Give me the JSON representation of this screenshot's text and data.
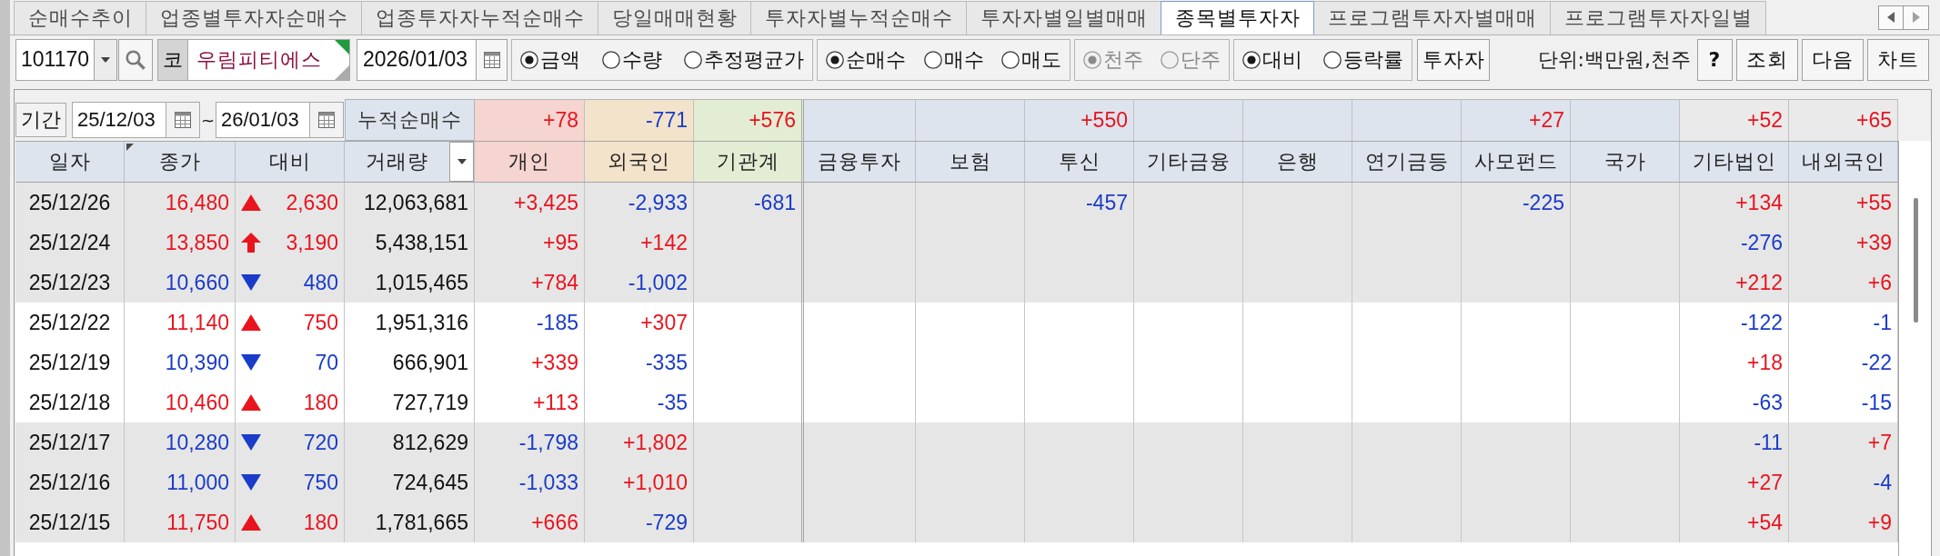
{
  "tabs": [
    {
      "label": "순매수추이",
      "selected": false
    },
    {
      "label": "업종별투자자순매수",
      "selected": false
    },
    {
      "label": "업종투자자누적순매수",
      "selected": false
    },
    {
      "label": "당일매매현황",
      "selected": false
    },
    {
      "label": "투자자별누적순매수",
      "selected": false
    },
    {
      "label": "투자자별일별매매",
      "selected": false
    },
    {
      "label": "종목별투자자",
      "selected": true
    },
    {
      "label": "프로그램투자자별매매",
      "selected": false
    },
    {
      "label": "프로그램투자자일별",
      "selected": false
    }
  ],
  "toolbar": {
    "stock_code": "101170",
    "market": "코",
    "stock_name": "우림피티에스",
    "date": "2026/01/03",
    "radio_groups": [
      {
        "disabled": false,
        "options": [
          {
            "label": "금액",
            "selected": true
          },
          {
            "label": "수량",
            "selected": false
          },
          {
            "label": "추정평균가",
            "selected": false
          }
        ]
      },
      {
        "disabled": false,
        "options": [
          {
            "label": "순매수",
            "selected": true
          },
          {
            "label": "매수",
            "selected": false
          },
          {
            "label": "매도",
            "selected": false
          }
        ]
      },
      {
        "disabled": true,
        "options": [
          {
            "label": "천주",
            "selected": true
          },
          {
            "label": "단주",
            "selected": false
          }
        ]
      },
      {
        "disabled": false,
        "options": [
          {
            "label": "대비",
            "selected": true
          },
          {
            "label": "등락률",
            "selected": false
          }
        ]
      }
    ],
    "investor_button": "투자자",
    "unit": "단위:백만원,천주",
    "help_button": "?",
    "buttons": [
      "조회",
      "다음",
      "차트"
    ]
  },
  "summary": {
    "period_label": "기간",
    "start_date": "25/12/03",
    "separator": "~",
    "end_date": "26/01/03",
    "label": "누적순매수",
    "values": {
      "individual": {
        "text": "+78",
        "negative": false
      },
      "foreign": {
        "text": "-771",
        "negative": true
      },
      "institution_total": {
        "text": "+576",
        "negative": false
      },
      "investment_trust": {
        "text": "+550",
        "negative": false
      },
      "private_fund": {
        "text": "+27",
        "negative": false
      },
      "other_corporation": {
        "text": "+52",
        "negative": false
      },
      "domestic_foreign": {
        "text": "+65",
        "negative": false
      }
    }
  },
  "table": {
    "columns": [
      {
        "label": "일자",
        "kind": "base",
        "dropdown": false,
        "flagged": false
      },
      {
        "label": "종가",
        "kind": "base",
        "dropdown": false,
        "flagged": true
      },
      {
        "label": "대비",
        "kind": "base",
        "dropdown": false,
        "flagged": false
      },
      {
        "label": "거래량",
        "kind": "base",
        "dropdown": true,
        "flagged": false
      },
      {
        "label": "개인",
        "kind": "individual",
        "dropdown": false,
        "flagged": false
      },
      {
        "label": "외국인",
        "kind": "foreign",
        "dropdown": false,
        "flagged": false
      },
      {
        "label": "기관계",
        "kind": "institution_total",
        "dropdown": false,
        "flagged": false
      },
      {
        "label": "금융투자",
        "kind": "institution",
        "dropdown": false,
        "flagged": false
      },
      {
        "label": "보험",
        "kind": "institution",
        "dropdown": false,
        "flagged": false
      },
      {
        "label": "투신",
        "kind": "institution",
        "dropdown": false,
        "flagged": false
      },
      {
        "label": "기타금융",
        "kind": "institution",
        "dropdown": false,
        "flagged": false
      },
      {
        "label": "은행",
        "kind": "institution",
        "dropdown": false,
        "flagged": false
      },
      {
        "label": "연기금등",
        "kind": "institution",
        "dropdown": false,
        "flagged": false
      },
      {
        "label": "사모펀드",
        "kind": "institution",
        "dropdown": false,
        "flagged": false
      },
      {
        "label": "국가",
        "kind": "institution",
        "dropdown": false,
        "flagged": false
      },
      {
        "label": "기타법인",
        "kind": "other",
        "dropdown": false,
        "flagged": false
      },
      {
        "label": "내외국인",
        "kind": "other",
        "dropdown": false,
        "flagged": false
      }
    ],
    "rows": [
      {
        "date": "25/12/26",
        "close": "16,480",
        "kind": "up",
        "change": "2,630",
        "volume": "12,063,681",
        "values": {
          "individual": {
            "text": "+3,425",
            "negative": false
          },
          "foreign": {
            "text": "-2,933",
            "negative": true
          },
          "institution_total": {
            "text": "-681",
            "negative": true
          },
          "investment_trust": {
            "text": "-457",
            "negative": true
          },
          "private_fund": {
            "text": "-225",
            "negative": true
          },
          "other_corporation": {
            "text": "+134",
            "negative": false
          },
          "domestic_foreign": {
            "text": "+55",
            "negative": false
          }
        }
      },
      {
        "date": "25/12/24",
        "close": "13,850",
        "kind": "limit_up",
        "change": "3,190",
        "volume": "5,438,151",
        "values": {
          "individual": {
            "text": "+95",
            "negative": false
          },
          "foreign": {
            "text": "+142",
            "negative": false
          },
          "other_corporation": {
            "text": "-276",
            "negative": true
          },
          "domestic_foreign": {
            "text": "+39",
            "negative": false
          }
        }
      },
      {
        "date": "25/12/23",
        "close": "10,660",
        "kind": "down",
        "change": "480",
        "volume": "1,015,465",
        "values": {
          "individual": {
            "text": "+784",
            "negative": false
          },
          "foreign": {
            "text": "-1,002",
            "negative": true
          },
          "other_corporation": {
            "text": "+212",
            "negative": false
          },
          "domestic_foreign": {
            "text": "+6",
            "negative": false
          }
        }
      },
      {
        "date": "25/12/22",
        "close": "11,140",
        "kind": "up",
        "change": "750",
        "volume": "1,951,316",
        "values": {
          "individual": {
            "text": "-185",
            "negative": true
          },
          "foreign": {
            "text": "+307",
            "negative": false
          },
          "other_corporation": {
            "text": "-122",
            "negative": true
          },
          "domestic_foreign": {
            "text": "-1",
            "negative": true
          }
        }
      },
      {
        "date": "25/12/19",
        "close": "10,390",
        "kind": "down",
        "change": "70",
        "volume": "666,901",
        "values": {
          "individual": {
            "text": "+339",
            "negative": false
          },
          "foreign": {
            "text": "-335",
            "negative": true
          },
          "other_corporation": {
            "text": "+18",
            "negative": false
          },
          "domestic_foreign": {
            "text": "-22",
            "negative": true
          }
        }
      },
      {
        "date": "25/12/18",
        "close": "10,460",
        "kind": "up",
        "change": "180",
        "volume": "727,719",
        "values": {
          "individual": {
            "text": "+113",
            "negative": false
          },
          "foreign": {
            "text": "-35",
            "negative": true
          },
          "other_corporation": {
            "text": "-63",
            "negative": true
          },
          "domestic_foreign": {
            "text": "-15",
            "negative": true
          }
        }
      },
      {
        "date": "25/12/17",
        "close": "10,280",
        "kind": "down",
        "change": "720",
        "volume": "812,629",
        "values": {
          "individual": {
            "text": "-1,798",
            "negative": true
          },
          "foreign": {
            "text": "+1,802",
            "negative": false
          },
          "other_corporation": {
            "text": "-11",
            "negative": true
          },
          "domestic_foreign": {
            "text": "+7",
            "negative": false
          }
        }
      },
      {
        "date": "25/12/16",
        "close": "11,000",
        "kind": "down",
        "change": "750",
        "volume": "724,645",
        "values": {
          "individual": {
            "text": "-1,033",
            "negative": true
          },
          "foreign": {
            "text": "+1,010",
            "negative": false
          },
          "other_corporation": {
            "text": "+27",
            "negative": false
          },
          "domestic_foreign": {
            "text": "-4",
            "negative": true
          }
        }
      },
      {
        "date": "25/12/15",
        "close": "11,750",
        "kind": "up",
        "change": "180",
        "volume": "1,781,665",
        "values": {
          "individual": {
            "text": "+666",
            "negative": false
          },
          "foreign": {
            "text": "-729",
            "negative": true
          },
          "other_corporation": {
            "text": "+54",
            "negative": false
          },
          "domestic_foreign": {
            "text": "+9",
            "negative": false
          }
        }
      }
    ]
  }
}
